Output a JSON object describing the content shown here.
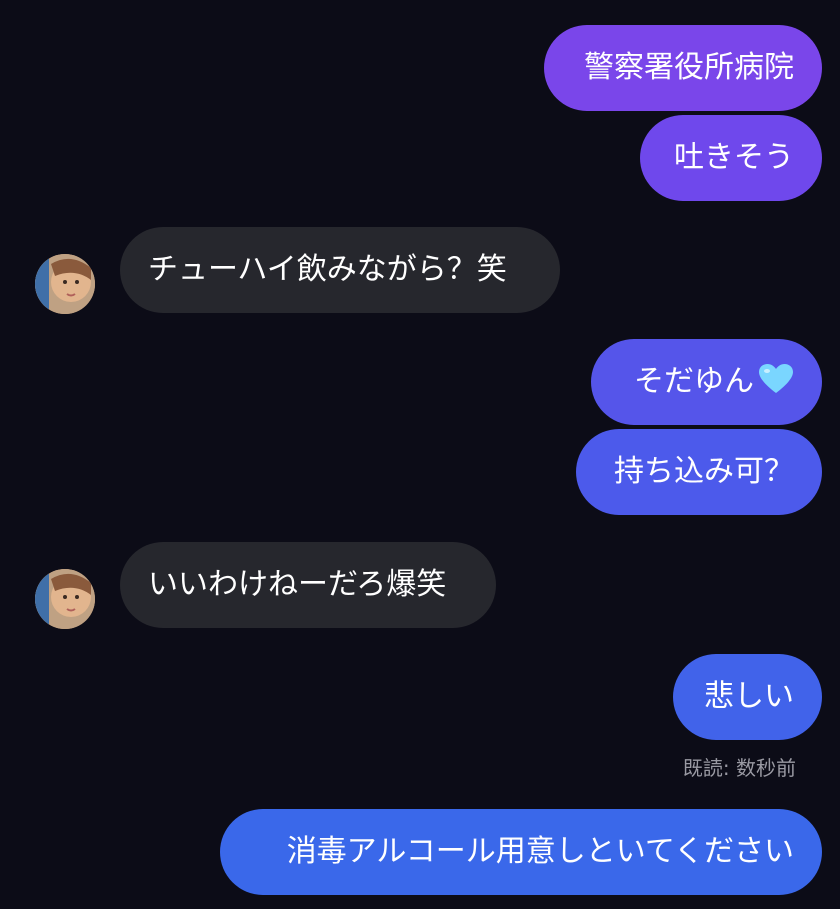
{
  "messages": [
    {
      "id": "m1",
      "sender": "me",
      "text": "警察署役所病院"
    },
    {
      "id": "m2",
      "sender": "me",
      "text": "吐きそう"
    },
    {
      "id": "m3",
      "sender": "them",
      "text": "チューハイ飲みながら？笑"
    },
    {
      "id": "m4",
      "sender": "me",
      "text": "そだゆん",
      "emoji": "light-blue-heart-icon"
    },
    {
      "id": "m5",
      "sender": "me",
      "text": "持ち込み可？"
    },
    {
      "id": "m6",
      "sender": "them",
      "text": "いいわけねーだろ爆笑"
    },
    {
      "id": "m7",
      "sender": "me",
      "text": "悲しい"
    },
    {
      "id": "m8",
      "sender": "me",
      "text": "消毒アルコール用意しといてください"
    }
  ],
  "read_receipt": "既読: 数秒前",
  "colors": {
    "background": "#0c0c17",
    "received_bubble": "#26272d",
    "sent_gradient_top": "#7a46ea",
    "sent_gradient_bottom": "#3a68ea",
    "heart": "#7ad6ff"
  }
}
